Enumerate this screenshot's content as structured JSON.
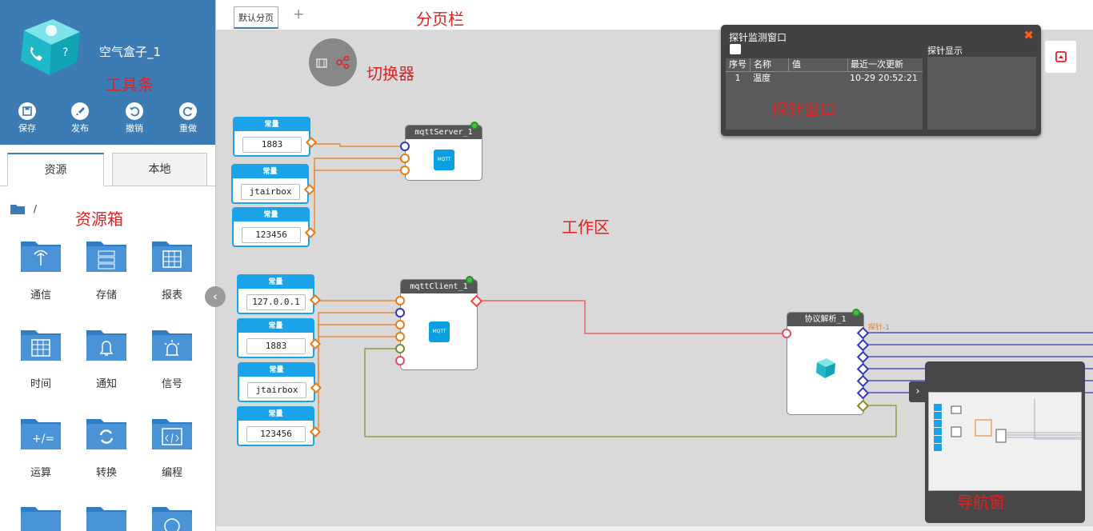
{
  "toolbar": {
    "app_name": "空气盒子_1",
    "annotation": "工具条",
    "buttons": [
      {
        "label": "保存",
        "icon": "save-icon"
      },
      {
        "label": "发布",
        "icon": "rocket-icon"
      },
      {
        "label": "撤销",
        "icon": "undo-icon"
      },
      {
        "label": "重做",
        "icon": "redo-icon"
      }
    ],
    "accent": "#3d7bb5"
  },
  "resource_tabs": [
    "资源",
    "本地"
  ],
  "resource_box": {
    "path": "/",
    "annotation": "资源箱",
    "folders": [
      "通信",
      "存储",
      "报表",
      "时间",
      "通知",
      "信号",
      "运算",
      "转换",
      "编程"
    ]
  },
  "page_bar": {
    "tab": "默认分页",
    "add": "+",
    "annotation": "分页栏"
  },
  "switcher": {
    "annotation": "切换器"
  },
  "workspace": {
    "annotation": "工作区",
    "const_header": "常量",
    "group1_consts": [
      "1883",
      "jtairbox",
      "123456"
    ],
    "group2_consts": [
      "127.0.0.1",
      "1883",
      "jtairbox",
      "123456"
    ],
    "mqtt_server": {
      "title": "mqttServer_1",
      "icon_text": "MQTT"
    },
    "mqtt_client": {
      "title": "mqttClient_1",
      "icon_text": "MQTT"
    },
    "parser": {
      "title": "协议解析_1",
      "probe_tag": "探针-1"
    }
  },
  "probe": {
    "title": "探针监测窗口",
    "annotation": "探针窗口",
    "close": "✖",
    "columns": [
      "序号",
      "名称",
      "值",
      "最近一次更新"
    ],
    "rows": [
      {
        "idx": "1",
        "name": "温度",
        "value": "",
        "time": "10-29 20:52:21"
      }
    ],
    "display_label": "探针显示"
  },
  "navigator": {
    "annotation": "导航窗",
    "toggle": "›"
  },
  "collapse": "‹"
}
